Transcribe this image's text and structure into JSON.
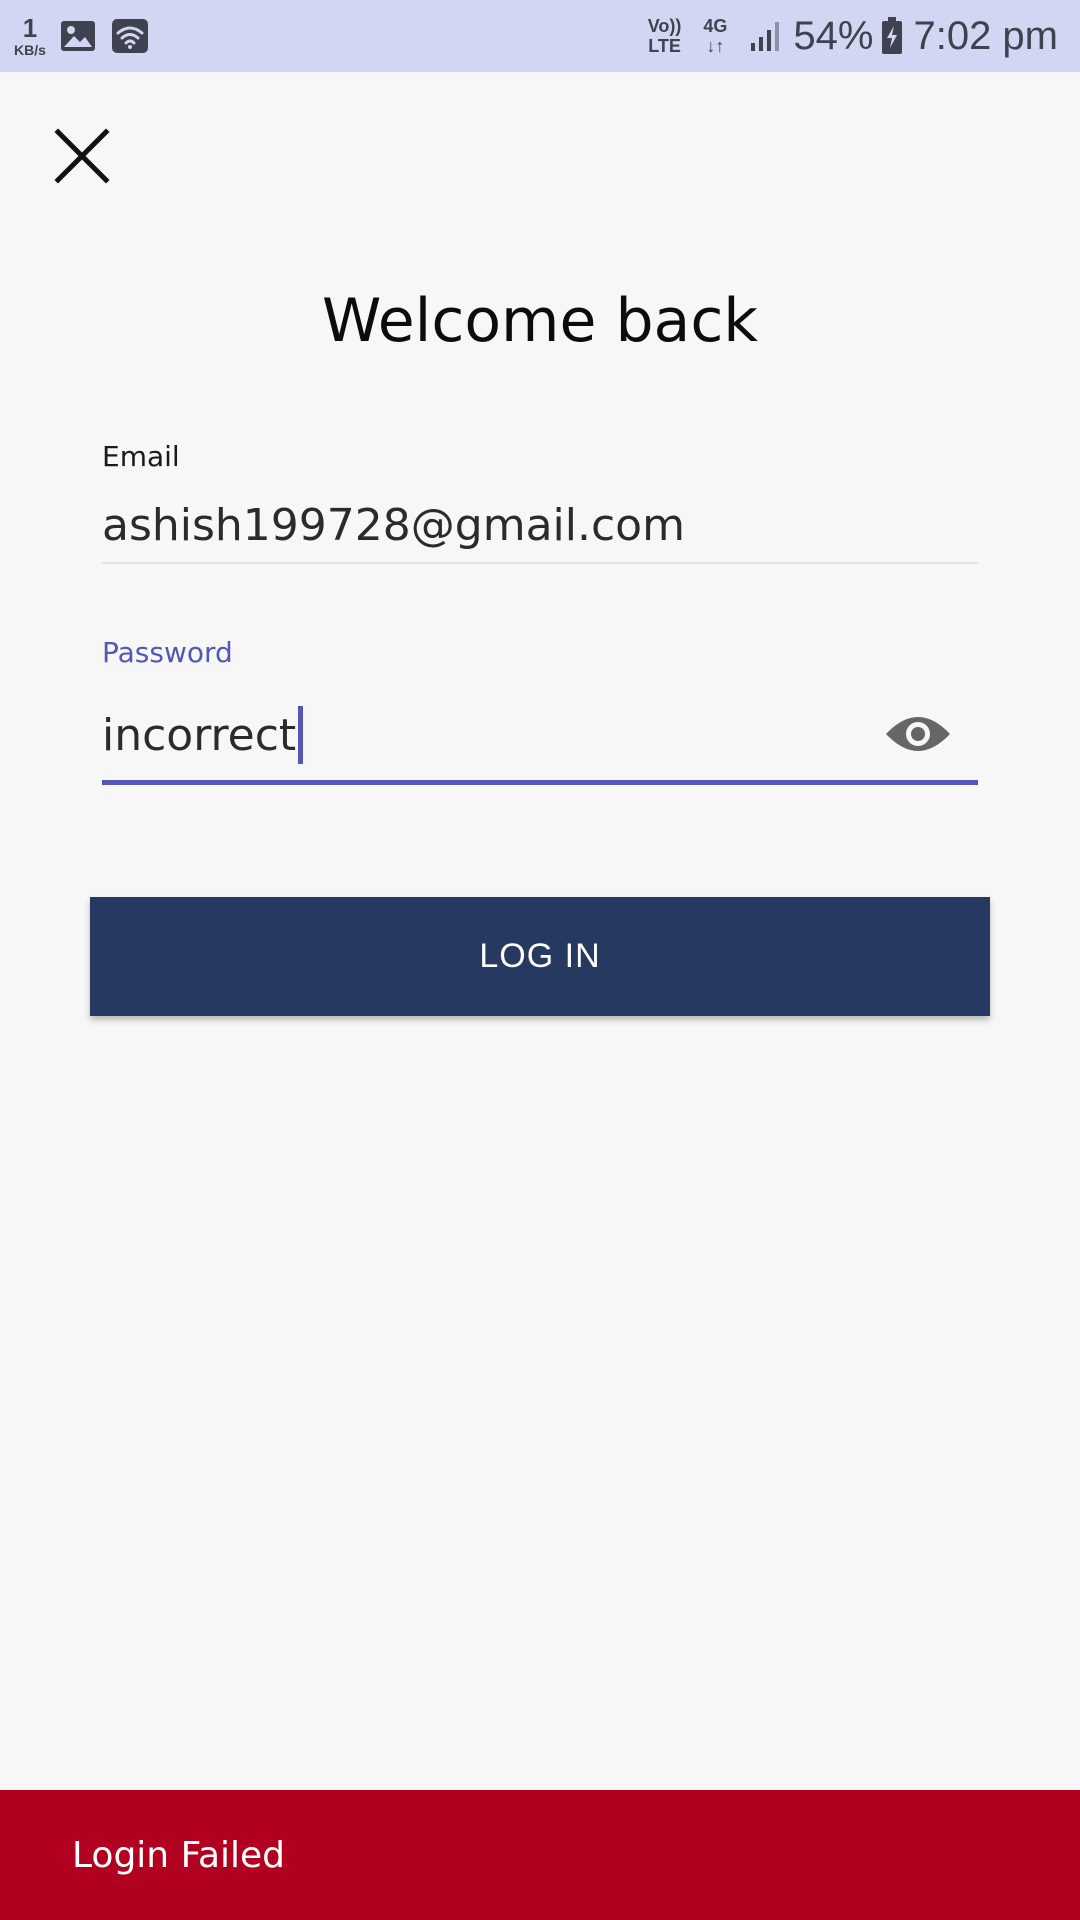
{
  "status_bar": {
    "speed_value": "1",
    "speed_unit": "KB/s",
    "volte_top": "Vo))",
    "volte_bottom": "LTE",
    "network_type": "4G",
    "network_arrows": "↓↑",
    "battery_percent": "54%",
    "time": "7:02 pm",
    "icons": [
      "image-icon",
      "wifi-icon",
      "signal-icon",
      "battery-charging-icon"
    ]
  },
  "header": {
    "close_icon": "close-icon",
    "title": "Welcome back"
  },
  "form": {
    "email": {
      "label": "Email",
      "value": "ashish199728@gmail.com"
    },
    "password": {
      "label": "Password",
      "value": "incorrect",
      "visibility_icon": "eye-icon"
    },
    "login_label": "LOG IN"
  },
  "snackbar": {
    "message": "Login Failed"
  },
  "colors": {
    "status_bar_bg": "#d3d6f2",
    "page_bg": "#f7f7f7",
    "accent": "#5457b6",
    "button_bg": "#263961",
    "error_bg": "#b20020"
  }
}
